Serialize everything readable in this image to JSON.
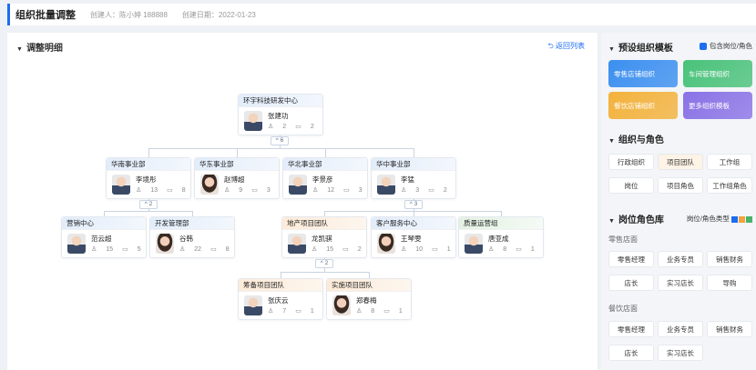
{
  "header": {
    "title": "组织批量调整",
    "creator": "创建人：陈小婷 188888",
    "date": "创建日期：2022-01-23"
  },
  "main": {
    "section_title": "调整明细",
    "back_label": "返回列表"
  },
  "org": {
    "root": {
      "name": "环宇科技研发中心",
      "person": "张建功",
      "people": "2",
      "posts": "2"
    },
    "toggle_root": "^ 6",
    "l1": [
      {
        "name": "华南事业部",
        "person": "李境彤",
        "people": "13",
        "posts": "8"
      },
      {
        "name": "华东事业部",
        "person": "赵博超",
        "people": "9",
        "posts": "3"
      },
      {
        "name": "华北事业部",
        "person": "李景彦",
        "people": "12",
        "posts": "3"
      },
      {
        "name": "华中事业部",
        "person": "李猛",
        "people": "3",
        "posts": "2"
      }
    ],
    "toggle_south": "^ 2",
    "toggle_central": "^ 3",
    "l2": [
      {
        "name": "营销中心",
        "person": "范云超",
        "people": "15",
        "posts": "5"
      },
      {
        "name": "开发管理部",
        "person": "谷韩",
        "people": "22",
        "posts": "8"
      },
      {
        "name": "地产项目团队",
        "person": "龙凯骐",
        "people": "15",
        "posts": "2"
      },
      {
        "name": "客户服务中心",
        "person": "王琴雯",
        "people": "10",
        "posts": "1"
      },
      {
        "name": "质量运营组",
        "person": "唐亚成",
        "people": "8",
        "posts": "1"
      }
    ],
    "toggle_estate": "^ 2",
    "l3": [
      {
        "name": "筹备项目团队",
        "person": "张庆云",
        "people": "7",
        "posts": "1"
      },
      {
        "name": "实施项目团队",
        "person": "郑春梅",
        "people": "8",
        "posts": "1"
      }
    ]
  },
  "sidebar": {
    "preset_title": "预设组织模板",
    "include_label": "包含岗位/角色",
    "templates": [
      "零售店铺组织",
      "车间管理组织",
      "餐饮店铺组织",
      "更多组织模板"
    ],
    "template_colors": [
      "#3b8ff0",
      "#49c27a",
      "#f3b23c",
      "#8a72e6"
    ],
    "org_role_title": "组织与角色",
    "org_role_chips": [
      "行政组织",
      "项目团队",
      "工作组",
      "岗位",
      "项目角色",
      "工作组角色"
    ],
    "lib_title": "岗位角色库",
    "lib_type_label": "岗位/角色类型",
    "retail_label": "零售店面",
    "retail_chips": [
      "零售经理",
      "业务专员",
      "销售财务",
      "店长",
      "实习店长",
      "导购"
    ],
    "dining_label": "餐饮店面",
    "dining_chips": [
      "零售经理",
      "业务专员",
      "销售财务",
      "店长",
      "实习店长"
    ]
  }
}
